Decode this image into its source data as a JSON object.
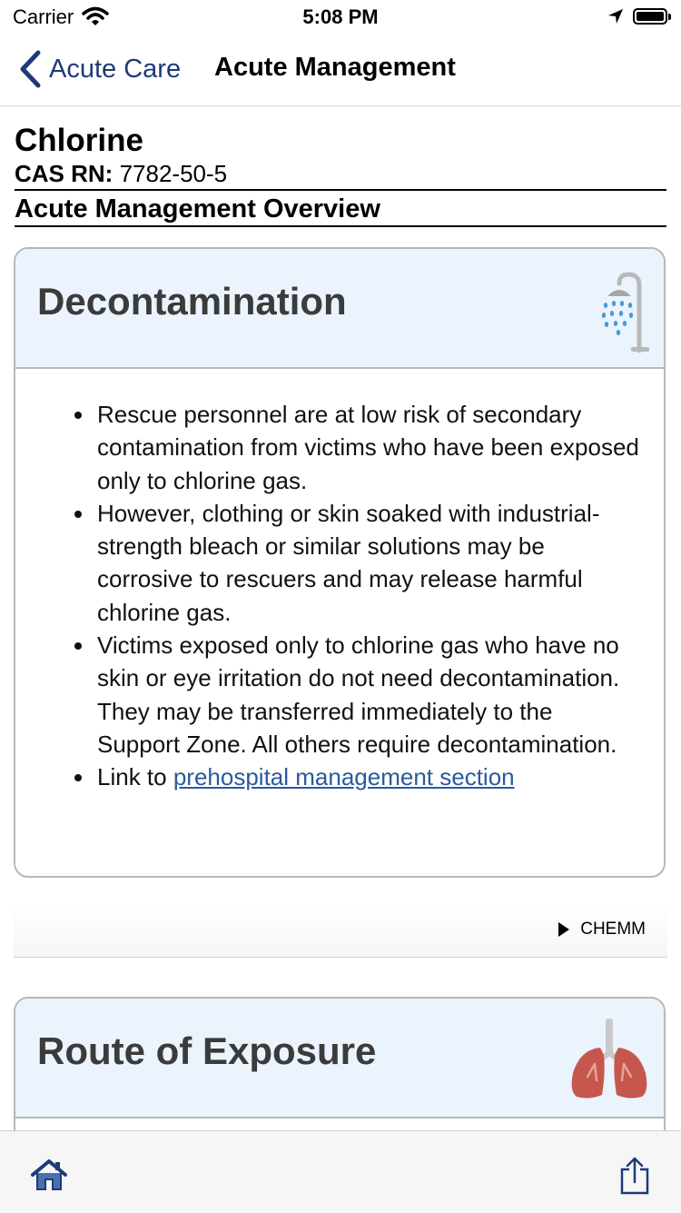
{
  "status_bar": {
    "carrier": "Carrier",
    "time": "5:08 PM"
  },
  "nav": {
    "back_label": "Acute Care",
    "title": "Acute Management"
  },
  "header": {
    "chemical": "Chlorine",
    "cas_label": "CAS RN:",
    "cas_value": "7782-50-5",
    "section": "Acute Management Overview"
  },
  "cards": [
    {
      "title": "Decontamination",
      "icon": "shower-icon",
      "bullets": [
        "Rescue personnel are at low risk of secondary contamination from victims who have been exposed only to chlorine gas.",
        "However, clothing or skin soaked with industrial-strength bleach or similar solutions may be corrosive to rescuers and may release harmful chlorine gas.",
        "Victims exposed only to chlorine gas who have no skin or eye irritation do not need decontamination. They may be transferred immediately to the Support Zone. All others require decontamination."
      ],
      "link_prefix": "Link to ",
      "link_text": "prehospital management section"
    },
    {
      "title": "Route of Exposure",
      "icon": "lungs-icon"
    }
  ],
  "source": {
    "label": "CHEMM"
  },
  "colors": {
    "accent": "#1e3a78",
    "link": "#2a5a9c",
    "card_header_bg": "#ebf3fc"
  }
}
